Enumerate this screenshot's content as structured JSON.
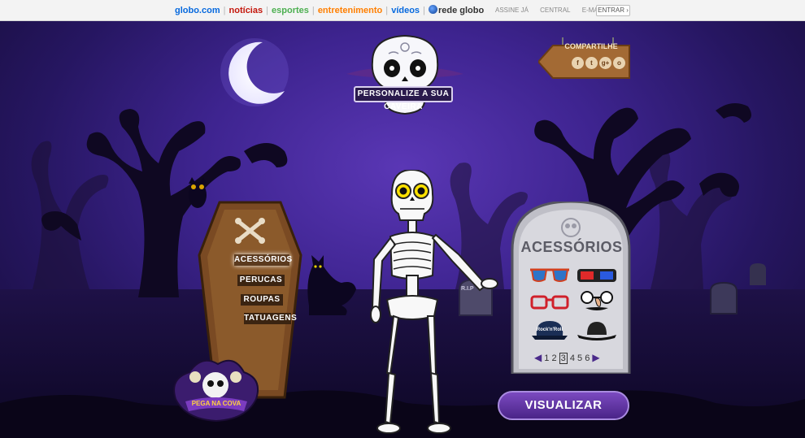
{
  "topbar": {
    "links": {
      "globo": "globo.com",
      "noticias": "notícias",
      "esportes": "esportes",
      "entretenimento": "entretenimento",
      "videos": "vídeos",
      "rede_globo": "rede globo"
    },
    "right": {
      "assine": "ASSINE JÁ",
      "central": "CENTRAL",
      "email": "E-MAIL▾",
      "entrar": "ENTRAR ›"
    }
  },
  "logo": {
    "text": "PERSONALIZE A SUA CAVEIRA"
  },
  "share": {
    "label": "COMPARTILHE",
    "icons": [
      "f",
      "t",
      "g+",
      "o"
    ]
  },
  "menu": {
    "items": [
      "ACESSÓRIOS",
      "PERUCAS",
      "ROUPAS",
      "TATUAGENS"
    ],
    "active": "ACESSÓRIOS"
  },
  "accessories": {
    "title": "ACESSÓRIOS",
    "items": [
      "sunglasses",
      "3d-glasses",
      "red-glasses",
      "nose-glasses",
      "rock-cap",
      "black-hat"
    ],
    "pager": {
      "pages": [
        "1",
        "2",
        "3",
        "4",
        "5",
        "6"
      ],
      "current": "3"
    }
  },
  "visualizar": "VISUALIZAR",
  "badge": {
    "text": "PEGA NA COVA"
  },
  "tombs": {
    "small": "R.I.P"
  },
  "colors": {
    "sky": "#3e2490",
    "wood": "#7a4a23",
    "accent": "#6b3cb0"
  }
}
